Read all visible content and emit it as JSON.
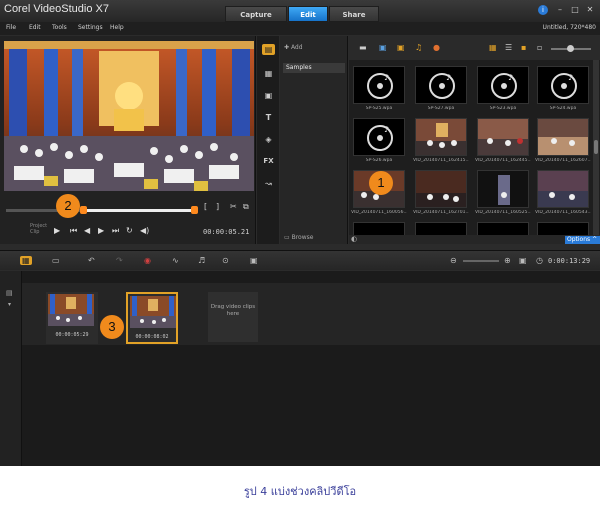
{
  "app": {
    "title": "Corel VideoStudio X7"
  },
  "tabs": [
    {
      "label": "Capture"
    },
    {
      "label": "Edit"
    },
    {
      "label": "Share"
    }
  ],
  "menu": [
    {
      "label": "File"
    },
    {
      "label": "Edit"
    },
    {
      "label": "Tools"
    },
    {
      "label": "Settings"
    },
    {
      "label": "Help"
    }
  ],
  "project_info": "Untitled, 720*480",
  "player": {
    "timecode": "00:00:05.21",
    "mode_project": "Project",
    "mode_clip": "Clip",
    "scrub_position": 0.4
  },
  "library": {
    "add_label": "Add",
    "folder": "Samples",
    "browse": "Browse",
    "options": "Options",
    "items": [
      {
        "label": "SP-S25.wpa",
        "kind": "audio"
      },
      {
        "label": "SP-S27.wpa",
        "kind": "audio"
      },
      {
        "label": "SP-S23.wpa",
        "kind": "audio"
      },
      {
        "label": "SP-S24.wpa",
        "kind": "audio"
      },
      {
        "label": "SP-S26.wpa",
        "kind": "audio"
      },
      {
        "label": "VID_20140711_162415...",
        "kind": "video"
      },
      {
        "label": "VID_20140711_162445...",
        "kind": "video"
      },
      {
        "label": "VID_20140711_162607...",
        "kind": "video"
      },
      {
        "label": "VID_20140711_160056...",
        "kind": "video"
      },
      {
        "label": "VID_20140711_162701...",
        "kind": "video"
      },
      {
        "label": "VID_20140711_160525...",
        "kind": "video"
      },
      {
        "label": "VID_20140711_160543...",
        "kind": "video"
      }
    ]
  },
  "timeline": {
    "timecode": "0:00:13:29",
    "clips": [
      {
        "time": "00:00:05:29"
      },
      {
        "time": "00:00:08:02"
      }
    ],
    "drop_hint": "Drag video clips here"
  },
  "callouts": [
    "1",
    "2",
    "3"
  ],
  "caption": "รูป 4 แบ่งช่วงคลิปวีดีโอ",
  "colors": {
    "accent": "#2a7bd8",
    "highlight": "#e2a227",
    "callout": "#f08a1c"
  }
}
